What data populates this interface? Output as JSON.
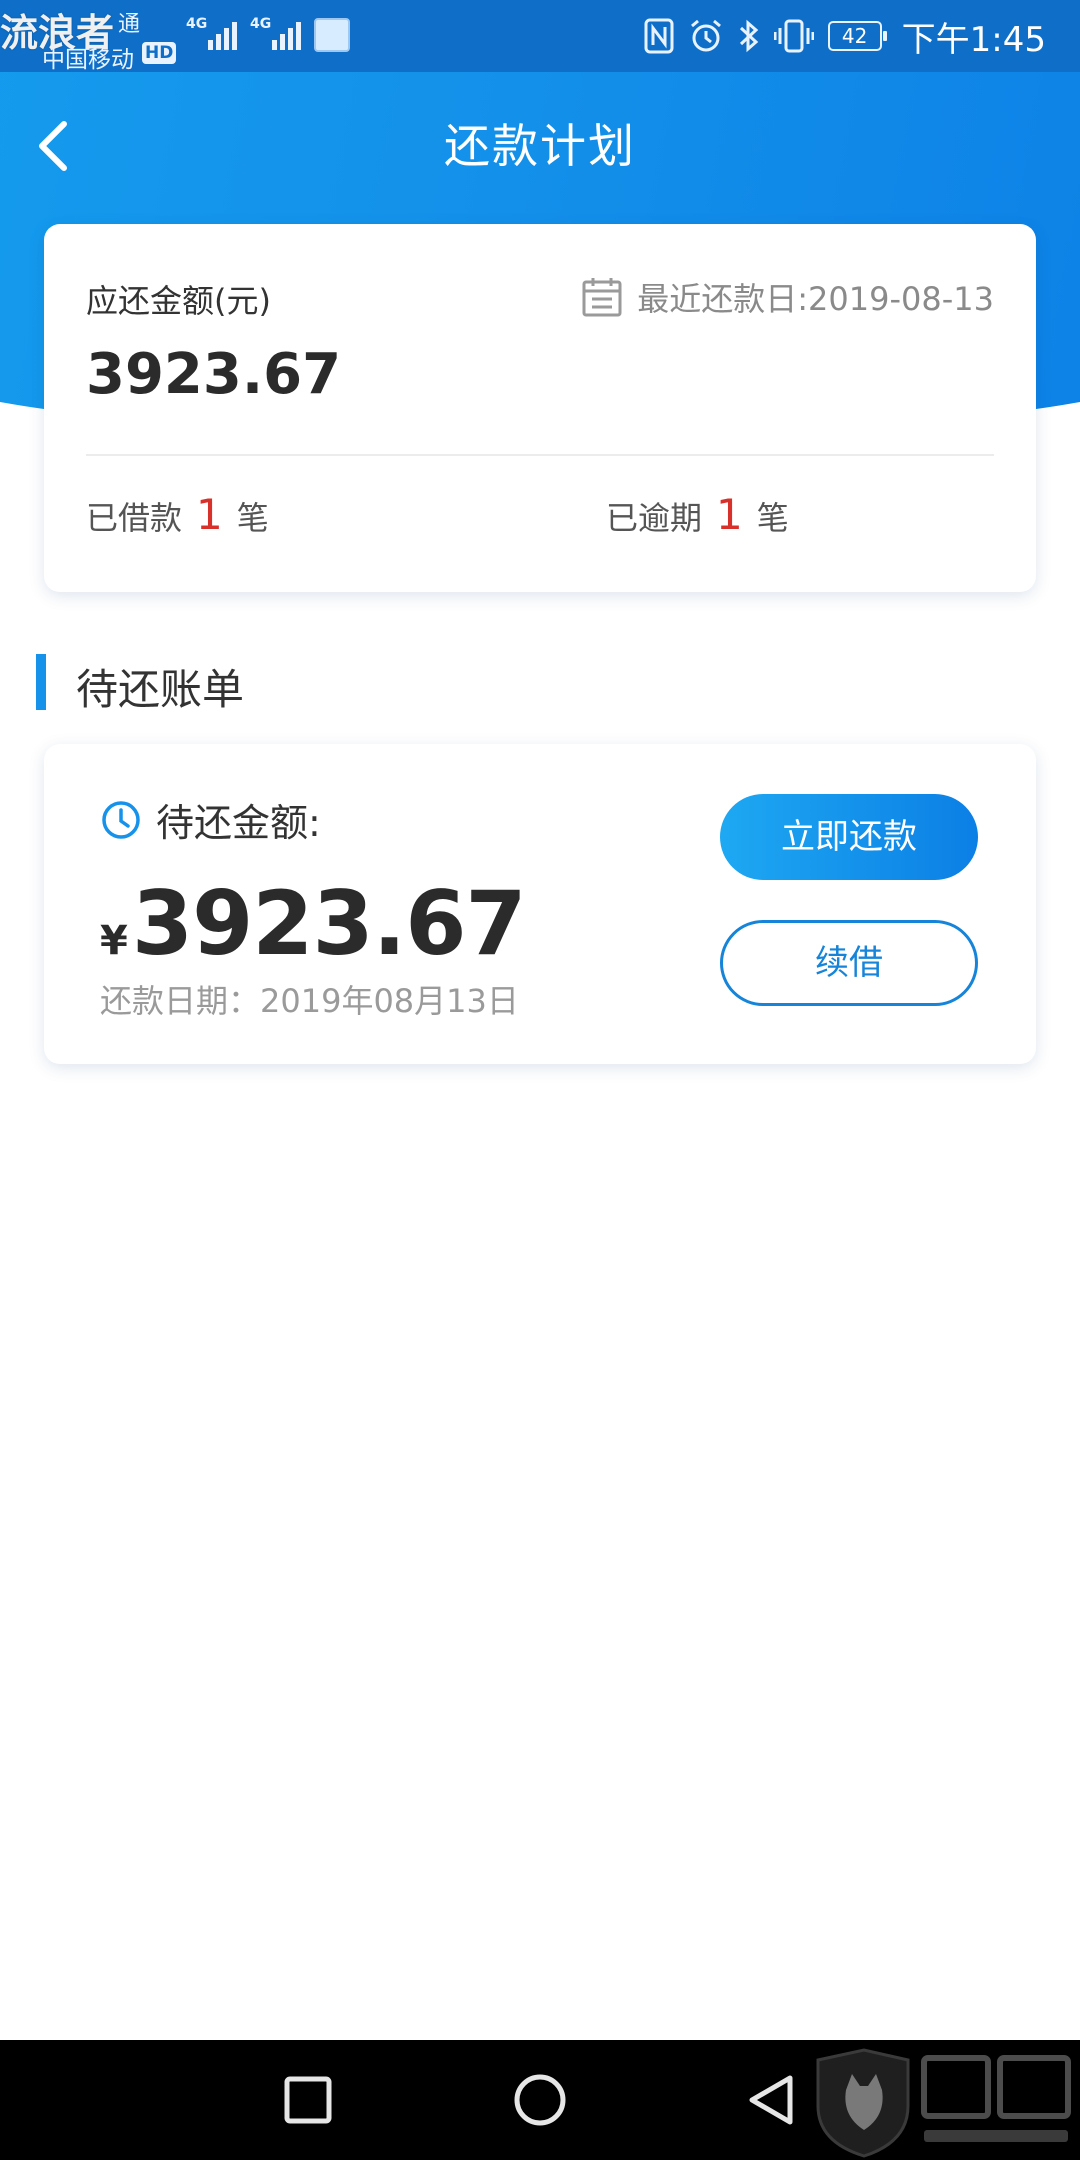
{
  "status_bar": {
    "watermark": "流浪者",
    "carrier_partial": "通",
    "carrier": "中国移动",
    "hd_badge": "HD",
    "signal_1": "4G",
    "signal_2": "4G",
    "battery": "42",
    "time": "下午1:45"
  },
  "nav": {
    "title": "还款计划"
  },
  "summary": {
    "amount_label": "应还金额(元)",
    "amount": "3923.67",
    "recent_due_date": "最近还款日:2019-08-13",
    "borrowed_prefix": "已借款",
    "borrowed_count": "1",
    "borrowed_suffix": "笔",
    "overdue_prefix": "已逾期",
    "overdue_count": "1",
    "overdue_suffix": "笔"
  },
  "section": {
    "title": "待还账单"
  },
  "bill": {
    "label": "待还金额:",
    "currency": "¥",
    "amount": "3923.67",
    "due_date": "还款日期：2019年08月13日",
    "repay_button": "立即还款",
    "renew_button": "续借"
  },
  "colors": {
    "brand_blue": "#1492ea",
    "overdue_red": "#d8302a"
  },
  "watermark_logo": "黑猫 BLACK CAT"
}
